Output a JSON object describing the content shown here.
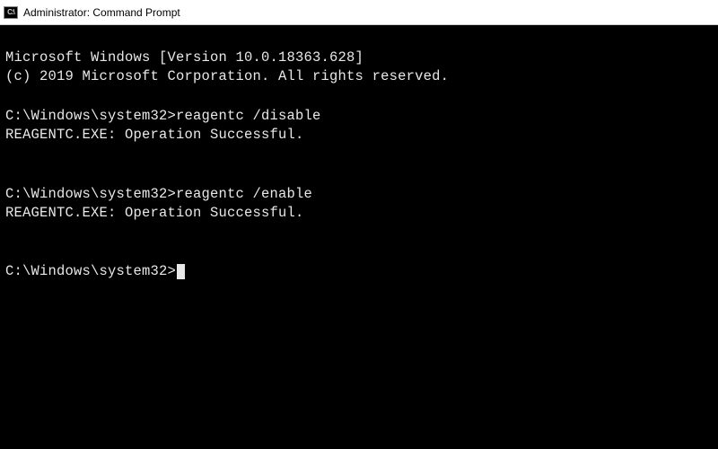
{
  "titlebar": {
    "icon_glyph": "C:\\",
    "title": "Administrator: Command Prompt"
  },
  "terminal": {
    "version_line": "Microsoft Windows [Version 10.0.18363.628]",
    "copyright_line": "(c) 2019 Microsoft Corporation. All rights reserved.",
    "prompt": "C:\\Windows\\system32>",
    "block1": {
      "command": "reagentc /disable",
      "result": "REAGENTC.EXE: Operation Successful."
    },
    "block2": {
      "command": "reagentc /enable",
      "result": "REAGENTC.EXE: Operation Successful."
    }
  }
}
